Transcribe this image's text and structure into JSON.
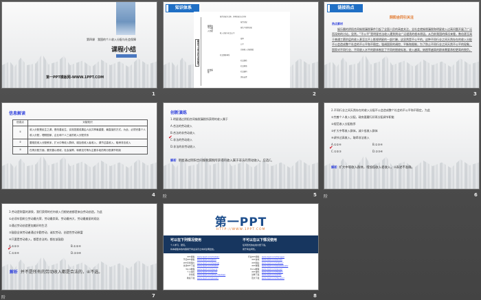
{
  "slides": [
    {
      "number": "1",
      "chapter": "第四课　我国的个人收入分配与社会保障",
      "title": "课程小结",
      "footer": "第一PPT模板网-WWW.1PPT.COM"
    },
    {
      "number": "2",
      "tag": "知识体系",
      "root": "我国的个人收入分配与社会保障",
      "branches": [
        "我国的个人收入分配",
        "社会保障"
      ],
      "nodes": [
        "按劳分配为主体、多种分配方式并存",
        "按劳分配",
        "按生产要素分配",
        "收入分配与社会公平",
        "效率",
        "公平",
        "完善收入分配制度",
        "社会保险",
        "社会救助",
        "社会福利",
        "优抚安置",
        "社会保障体系"
      ]
    },
    {
      "number": "3",
      "tag": "链接热点",
      "heading": "阴阳合同引关注",
      "subheading": "热点素材",
      "body": "娱乐圈的阴阳合同偷税漏税事件引起了全国人民的高度关注，全社会就偷税漏税和明星收入过高问题开展了广泛而深刻的讨论。显然，“不公平”是明星合法收入遭到舆论广泛谴责的根本原因。从目前我国的情况来看，数倍甚至高于普通工薪阶层的收入甚至比不上影视明星的一部片酬，这显然是不公平的。这种不同行业之间天然存在的收入分配不公会造成整个社会的不公平和不稳定。强调国家的调控、平衡和限制，为了防止不同行业之间天然不公平的现象，国家对不同行业、不同收入水平的群体制定了不同的税收标准，收入越高，纳税率越高的群体需要承担更高的税负。"
    },
    {
      "number": "4",
      "heading": "信息解读",
      "columns": [
        "信息点",
        "对接知识"
      ],
      "rows": [
        [
          "①",
          "收入分配是民生之源，是改善民生、实现发展成果由人民共享最重要、最直接的方式。为此，必须完善个人收入分配，理顺国家、企业和个人三者的收入分配关系"
        ],
        [
          "②",
          "要规范收入分配秩序，扩大中等收入群体，增加低收入者收入，调节过高收入，取缔非法收入"
        ],
        [
          "③",
          "在再分配方面，要完善以税收、社会保障、转移支付等为主要手段的再分配调节机制"
        ]
      ]
    },
    {
      "number": "5",
      "heading": "创新演练",
      "question": "1.明星通过阴阳合同偷税漏税所获得的收入属于",
      "options": [
        "A.合法的劳动收入",
        "B.合法的非劳动收入",
        "C.非法的劳动收入",
        "D.非法的非劳动收入"
      ],
      "answer_label": "解析",
      "answer": "明星通过阴阳合同偷税漏税所获得的收入属于非法的劳动收入。应选C。",
      "anim": "阶"
    },
    {
      "number": "6",
      "question": "2.不同行业之间天然存在的收入分配不公会造成整个社会的不公平和不稳定。为此",
      "items": [
        "①完善个人收入分配，政府要履行好再分配调节职能",
        "②规范收入分配秩序",
        "③扩大中等收入群体，减少低收入群体",
        "④调节过高收入，取缔非法收入"
      ],
      "options": [
        "A.①②④",
        "B.①③④",
        "C.①②③",
        "D.②③④"
      ],
      "answer_label": "解析",
      "answer": "扩大中等收入群体，增加低收入者收入，③表述不准确。",
      "anim": "阶"
    },
    {
      "number": "7",
      "question": "3.劳动是财富的源泉，我们获得的任何收入归根结底都是来自劳动创造。为此",
      "items": [
        "①必须牢固树立劳动最光荣、劳动最崇高、劳动最伟大、劳动最美丽的观念",
        "②通过劳动创造更加美好的生活",
        "③鼓励全体劳动者通过辛勤劳动、诚实劳动、创造性劳动致富",
        "④只要是劳动收入，都是合法的，都应该鼓励"
      ],
      "options": [
        "A.①②③",
        "B.①②④",
        "C.①③④",
        "D.②③④"
      ],
      "answer_label": "解析",
      "answer": "并不是所有的劳动收入都是合法的，④不选。",
      "anim": "阶"
    },
    {
      "number": "8",
      "logo": "第一PPT",
      "url": "HTTP://WWW.1PPT.COM",
      "can_title": "可以在下列情况使用",
      "can_items": [
        "个人学习、研究。",
        "将本模板中的内容用于商业演示之中并注明出处。"
      ],
      "cannot_title": "不可以在以下情况使用",
      "cannot_items": [
        "任何形式的在线付费下载。",
        "用于商业转售。"
      ],
      "left_links": [
        [
          "PPT模板：",
          "www.1ppt.com/moban/"
        ],
        [
          "节日PPT模板：",
          "www.1ppt.com/jieri/"
        ],
        [
          "PPT背景图片：",
          "www.1ppt.com/beijing/"
        ],
        [
          "优秀PPT下载：",
          "www.1ppt.com/xiazai/"
        ],
        [
          "Word教程：",
          "www.1ppt.com/word/"
        ],
        [
          "个人简历：",
          "www.1ppt.com/jianli/"
        ],
        [
          "手抄报：",
          "www.1ppt.com/shouchaobao/"
        ],
        [
          "教案下载：",
          "www.1ppt.com/jiaoan/"
        ]
      ],
      "right_links": [
        [
          "行业PPT模板：",
          "www.1ppt.com/hangye/"
        ],
        [
          "PPT素材：",
          "www.1ppt.com/sucai/"
        ],
        [
          "PPT图表：",
          "www.1ppt.com/tubiao/"
        ],
        [
          "PPT教程：",
          "www.1ppt.com/powerpoint/"
        ],
        [
          "Excel教程：",
          "www.1ppt.com/excel/"
        ],
        [
          "PPT课件：",
          "www.1ppt.com/kejian/"
        ],
        [
          "试卷下载：",
          "www.1ppt.com/shiti/"
        ],
        [
          "范文下载：",
          "www.1ppt.com/fanwen/"
        ]
      ]
    }
  ]
}
